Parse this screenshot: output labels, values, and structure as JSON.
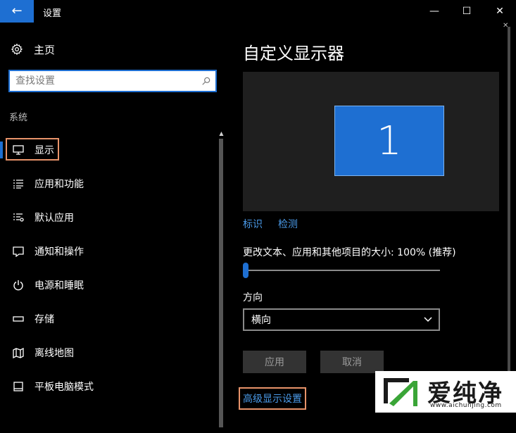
{
  "window": {
    "title": "设置",
    "back_icon": "←",
    "minimize_icon": "—",
    "maximize_icon": "☐",
    "close_icon": "✕"
  },
  "sidebar": {
    "home_label": "主页",
    "search_placeholder": "查找设置",
    "section_label": "系统",
    "items": [
      {
        "label": "显示",
        "icon": "monitor-icon",
        "active": true
      },
      {
        "label": "应用和功能",
        "icon": "list-icon"
      },
      {
        "label": "默认应用",
        "icon": "default-apps-icon"
      },
      {
        "label": "通知和操作",
        "icon": "notification-icon"
      },
      {
        "label": "电源和睡眠",
        "icon": "power-icon"
      },
      {
        "label": "存储",
        "icon": "storage-icon"
      },
      {
        "label": "离线地图",
        "icon": "map-icon"
      },
      {
        "label": "平板电脑模式",
        "icon": "tablet-icon"
      }
    ]
  },
  "main": {
    "title": "自定义显示器",
    "monitor_number": "1",
    "identify_link": "标识",
    "detect_link": "检测",
    "scale_label": "更改文本、应用和其他项目的大小: 100% (推荐)",
    "scale_level_fraction": 0.0,
    "orientation_label": "方向",
    "orientation_value": "横向",
    "apply_button": "应用",
    "cancel_button": "取消",
    "advanced_link": "高级显示设置"
  },
  "watermark": {
    "text": "爱纯净",
    "url": "www.aichunjing.com"
  },
  "colors": {
    "accent": "#1e6fd2",
    "highlight_box": "#e8936a",
    "link": "#4a9ae8",
    "background": "#000000"
  }
}
